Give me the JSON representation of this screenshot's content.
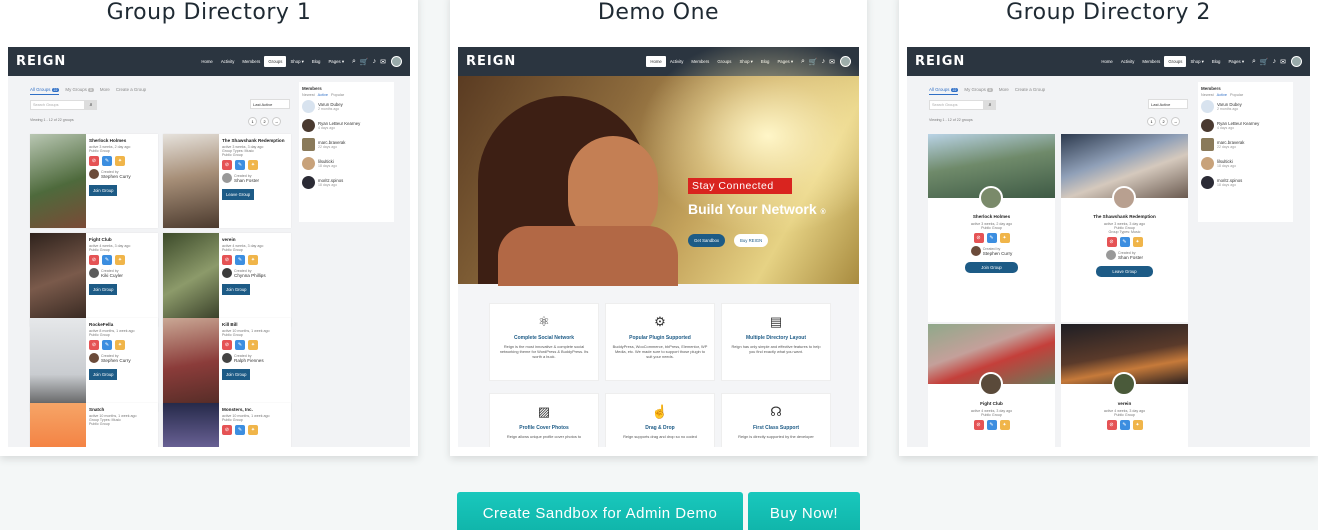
{
  "cards": [
    {
      "title": "Group Directory 1",
      "brand": "REIGN",
      "nav": [
        "Home",
        "Activity",
        "Members",
        "Groups",
        "Shop ▾",
        "Blog",
        "Pages ▾"
      ],
      "tabs": {
        "all": "All Groups",
        "all_count": "22",
        "mine": "My Groups",
        "mine_count": "0",
        "more": "More",
        "create": "Create a Group"
      },
      "search_placeholder": "Search Groups",
      "sort": "Last Active",
      "viewing": "Viewing 1 - 12 of 22 groups",
      "pages": [
        "1",
        "2",
        "→"
      ],
      "groups": [
        {
          "name": "Sherlock Holmes",
          "meta": "active 3 weeks, 2 day ago",
          "type": "Public Group",
          "extra": "",
          "created": "Created by",
          "by": "Stephen Curry",
          "btn": "Join Group"
        },
        {
          "name": "The Shawshank Redemption",
          "meta": "active 3 weeks, 3 day ago",
          "type": "Public Group",
          "extra": "Group Types: Music",
          "created": "Created by",
          "by": "Shan Foster",
          "btn": "Leave Group"
        },
        {
          "name": "Fight Club",
          "meta": "active 4 weeks, 3 day ago",
          "type": "Public Group",
          "extra": "",
          "created": "Created by",
          "by": "Kiki Cuyler",
          "btn": "Join Group"
        },
        {
          "name": "verein",
          "meta": "active 4 weeks, 3 day ago",
          "type": "Public Group",
          "extra": "",
          "created": "Created by",
          "by": "Chynna Phillips",
          "btn": "Join Group"
        },
        {
          "name": "RockeFella",
          "meta": "active 8 months, 1 week ago",
          "type": "Public Group",
          "extra": "",
          "created": "Created by",
          "by": "Stephen Curry",
          "btn": "Join Group"
        },
        {
          "name": "Kill Bill",
          "meta": "active 10 months, 1 week ago",
          "type": "Public Group",
          "extra": "",
          "created": "Created by",
          "by": "Ralph Fiennes",
          "btn": "Join Group"
        },
        {
          "name": "Snatch",
          "meta": "active 10 months, 1 week ago",
          "type": "Public Group",
          "extra": "Group Types: Music"
        },
        {
          "name": "Monsters, Inc.",
          "meta": "active 10 months, 1 week ago",
          "type": "Public Group",
          "extra": ""
        }
      ],
      "members": {
        "title": "Members",
        "tabs": [
          "Newest",
          "Active",
          "Popular"
        ],
        "list": [
          {
            "name": "Varun Dubey",
            "meta": "2 months ago"
          },
          {
            "name": "Ryan LeBeur Kearney",
            "meta": "4 days ago"
          },
          {
            "name": "marc.braverak",
            "meta": "22 days ago"
          },
          {
            "name": "lilsulticki",
            "meta": "18 days ago"
          },
          {
            "name": "moritz.spinos",
            "meta": "18 days ago"
          }
        ]
      }
    },
    {
      "title": "Demo One",
      "brand": "REIGN",
      "nav": [
        "Home",
        "Activity",
        "Members",
        "Groups",
        "Shop ▾",
        "Blog",
        "Pages ▾"
      ],
      "hero": {
        "badge": "Stay Connected",
        "headline": "Build Your Network",
        "btn1": "Get Sandbox",
        "btn2": "Buy REIGN"
      },
      "features": [
        {
          "title": "Complete Social Network",
          "desc": "Reign is the most innovative & complete social networking theme for WordPress & BuddyPress. Its worth a buck.",
          "icon": "network-icon"
        },
        {
          "title": "Popular Plugin Supported",
          "desc": "BuddyPress, WooCommerce, bbPress, Elementor, WP Media, etc. We made sure to support those plugin to suit your needs.",
          "icon": "gear-icon"
        },
        {
          "title": "Multiple Directory Layout",
          "desc": "Reign has only simple and effective features to help you find exactly what you want.",
          "icon": "document-icon"
        },
        {
          "title": "Profile Cover Photos",
          "desc": "Reign allows unique profile cover photos to",
          "icon": "image-icon"
        },
        {
          "title": "Drag & Drop",
          "desc": "Reign supports drag and drop so no coded",
          "icon": "pointer-icon"
        },
        {
          "title": "First Class Support",
          "desc": "Reign is directly supported by the developer",
          "icon": "support-icon"
        }
      ]
    },
    {
      "title": "Group Directory 2",
      "brand": "REIGN",
      "nav": [
        "Home",
        "Activity",
        "Members",
        "Groups",
        "Shop ▾",
        "Blog",
        "Pages ▾"
      ],
      "tabs": {
        "all": "All Groups",
        "all_count": "22",
        "mine": "My Groups",
        "mine_count": "0",
        "more": "More",
        "create": "Create a Group"
      },
      "search_placeholder": "Search Groups",
      "sort": "Last Active",
      "viewing": "Viewing 1 - 12 of 22 groups",
      "pages": [
        "1",
        "2",
        "→"
      ],
      "groups": [
        {
          "name": "Sherlock Holmes",
          "meta": "active 3 weeks, 2 day ago",
          "type": "Public Group",
          "extra": "",
          "created": "Created by",
          "by": "Stephen Curry",
          "btn": "Join Group"
        },
        {
          "name": "The Shawshank Redemption",
          "meta": "active 3 weeks, 3 day ago",
          "type": "Public Group",
          "extra": "Group Types: Music",
          "created": "Created by",
          "by": "Shan Foster",
          "btn": "Leave Group"
        },
        {
          "name": "Fight Club",
          "meta": "active 4 weeks, 3 day ago",
          "type": "Public Group"
        },
        {
          "name": "verein",
          "meta": "active 4 weeks, 3 day ago",
          "type": "Public Group"
        }
      ],
      "members": {
        "title": "Members",
        "tabs": [
          "Newest",
          "Active",
          "Popular"
        ],
        "list": [
          {
            "name": "Varun Dubey",
            "meta": "2 months ago"
          },
          {
            "name": "Ryan LeBeur Kearney",
            "meta": "4 days ago"
          },
          {
            "name": "marc.braverak",
            "meta": "22 days ago"
          },
          {
            "name": "lilsulticki",
            "meta": "18 days ago"
          },
          {
            "name": "moritz.spinos",
            "meta": "18 days ago"
          }
        ]
      }
    }
  ],
  "cta": {
    "sandbox": "Create Sandbox for Admin Demo",
    "buy": "Buy Now!"
  },
  "colors": {
    "accent": "#15bfb4",
    "nav": "#2b3540",
    "brand_button": "#1d5b86",
    "badge_red": "#d9241f"
  }
}
